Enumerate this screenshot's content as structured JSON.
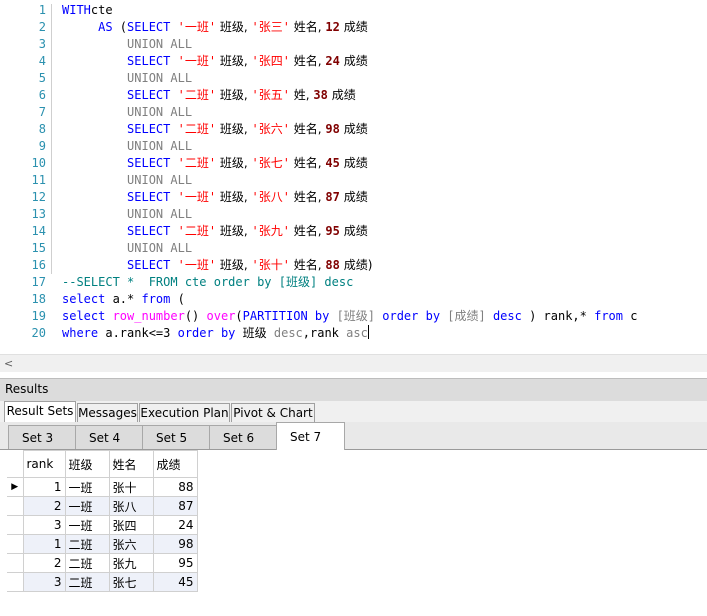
{
  "editor": {
    "line_numbers": [
      "1",
      "2",
      "3",
      "4",
      "5",
      "6",
      "7",
      "8",
      "9",
      "10",
      "11",
      "12",
      "13",
      "14",
      "15",
      "16",
      "17",
      "18",
      "19",
      "20"
    ],
    "lines": [
      [
        [
          "kw",
          "WITH"
        ],
        [
          "",
          "cte"
        ]
      ],
      [
        [
          "",
          "     "
        ],
        [
          "kw",
          "AS"
        ],
        [
          "",
          " ("
        ],
        [
          "kw",
          "SELECT "
        ],
        [
          "str",
          "'一班'"
        ],
        [
          "cn",
          " 班级, "
        ],
        [
          "str",
          "'张三'"
        ],
        [
          "cn",
          " 姓名, "
        ],
        [
          "num",
          "12"
        ],
        [
          "cn",
          " 成绩"
        ]
      ],
      [
        [
          "",
          "         "
        ],
        [
          "gr",
          "UNION ALL"
        ]
      ],
      [
        [
          "",
          "         "
        ],
        [
          "kw",
          "SELECT "
        ],
        [
          "str",
          "'一班'"
        ],
        [
          "cn",
          " 班级, "
        ],
        [
          "str",
          "'张四'"
        ],
        [
          "cn",
          " 姓名, "
        ],
        [
          "num",
          "24"
        ],
        [
          "cn",
          " 成绩"
        ]
      ],
      [
        [
          "",
          "         "
        ],
        [
          "gr",
          "UNION ALL"
        ]
      ],
      [
        [
          "",
          "         "
        ],
        [
          "kw",
          "SELECT "
        ],
        [
          "str",
          "'二班'"
        ],
        [
          "cn",
          " 班级, "
        ],
        [
          "str",
          "'张五'"
        ],
        [
          "cn",
          " 姓, "
        ],
        [
          "num",
          "38"
        ],
        [
          "cn",
          " 成绩"
        ]
      ],
      [
        [
          "",
          "         "
        ],
        [
          "gr",
          "UNION ALL"
        ]
      ],
      [
        [
          "",
          "         "
        ],
        [
          "kw",
          "SELECT "
        ],
        [
          "str",
          "'二班'"
        ],
        [
          "cn",
          " 班级, "
        ],
        [
          "str",
          "'张六'"
        ],
        [
          "cn",
          " 姓名, "
        ],
        [
          "num",
          "98"
        ],
        [
          "cn",
          " 成绩"
        ]
      ],
      [
        [
          "",
          "         "
        ],
        [
          "gr",
          "UNION ALL"
        ]
      ],
      [
        [
          "",
          "         "
        ],
        [
          "kw",
          "SELECT "
        ],
        [
          "str",
          "'二班'"
        ],
        [
          "cn",
          " 班级, "
        ],
        [
          "str",
          "'张七'"
        ],
        [
          "cn",
          " 姓名, "
        ],
        [
          "num",
          "45"
        ],
        [
          "cn",
          " 成绩"
        ]
      ],
      [
        [
          "",
          "         "
        ],
        [
          "gr",
          "UNION ALL"
        ]
      ],
      [
        [
          "",
          "         "
        ],
        [
          "kw",
          "SELECT "
        ],
        [
          "str",
          "'一班'"
        ],
        [
          "cn",
          " 班级, "
        ],
        [
          "str",
          "'张八'"
        ],
        [
          "cn",
          " 姓名, "
        ],
        [
          "num",
          "87"
        ],
        [
          "cn",
          " 成绩"
        ]
      ],
      [
        [
          "",
          "         "
        ],
        [
          "gr",
          "UNION ALL"
        ]
      ],
      [
        [
          "",
          "         "
        ],
        [
          "kw",
          "SELECT "
        ],
        [
          "str",
          "'二班'"
        ],
        [
          "cn",
          " 班级, "
        ],
        [
          "str",
          "'张九'"
        ],
        [
          "cn",
          " 姓名, "
        ],
        [
          "num",
          "95"
        ],
        [
          "cn",
          " 成绩"
        ]
      ],
      [
        [
          "",
          "         "
        ],
        [
          "gr",
          "UNION ALL"
        ]
      ],
      [
        [
          "",
          "         "
        ],
        [
          "kw",
          "SELECT "
        ],
        [
          "str",
          "'一班'"
        ],
        [
          "cn",
          " 班级, "
        ],
        [
          "str",
          "'张十'"
        ],
        [
          "cn",
          " 姓名, "
        ],
        [
          "num",
          "88"
        ],
        [
          "cn",
          " 成绩)"
        ]
      ],
      [
        [
          "cm",
          "--SELECT *  FROM cte order by [班级] desc"
        ]
      ],
      [
        [
          "kw",
          "select "
        ],
        [
          "",
          "a.* "
        ],
        [
          "kw",
          "from"
        ],
        [
          "",
          " ("
        ]
      ],
      [
        [
          "kw",
          "select "
        ],
        [
          "fn",
          "row_number"
        ],
        [
          "",
          "() "
        ],
        [
          "fn",
          "over"
        ],
        [
          "",
          "("
        ],
        [
          "kw",
          "PARTITION by "
        ],
        [
          "gr",
          "[班级]"
        ],
        [
          "kw",
          " order by "
        ],
        [
          "gr",
          "[成绩]"
        ],
        [
          "kw",
          " desc"
        ],
        [
          "",
          " ) rank,* "
        ],
        [
          "kw",
          "from"
        ],
        [
          "",
          " c"
        ]
      ],
      [
        [
          "kw",
          "where "
        ],
        [
          "",
          "a.rank<=3 "
        ],
        [
          "kw",
          "order by "
        ],
        [
          "cn",
          "班级"
        ],
        [
          "gr",
          " desc"
        ],
        [
          "",
          ",rank "
        ],
        [
          "gr",
          "asc"
        ]
      ]
    ]
  },
  "results": {
    "title": "Results",
    "top_tabs": [
      "Result Sets",
      "Messages",
      "Execution Plan",
      "Pivot & Chart"
    ],
    "set_tabs": [
      "Set 3",
      "Set 4",
      "Set 5",
      "Set 6",
      "Set 7"
    ],
    "active_set": "Set 7",
    "columns": [
      "rank",
      "班级",
      "姓名",
      "成绩"
    ],
    "row_pointer": "▶",
    "rows": [
      [
        "1",
        "一班",
        "张十",
        "88"
      ],
      [
        "2",
        "一班",
        "张八",
        "87"
      ],
      [
        "3",
        "一班",
        "张四",
        "24"
      ],
      [
        "1",
        "二班",
        "张六",
        "98"
      ],
      [
        "2",
        "二班",
        "张九",
        "95"
      ],
      [
        "3",
        "二班",
        "张七",
        "45"
      ]
    ]
  },
  "icons": {
    "scroll_left": "chevron-left-icon",
    "row_indicator": "triangle-right-icon"
  },
  "colors": {
    "keyword": "#0000ff",
    "string": "#ff0000",
    "number": "#800000",
    "comment": "#008080",
    "function": "#ff00ff",
    "line_number": "#2b91af"
  }
}
